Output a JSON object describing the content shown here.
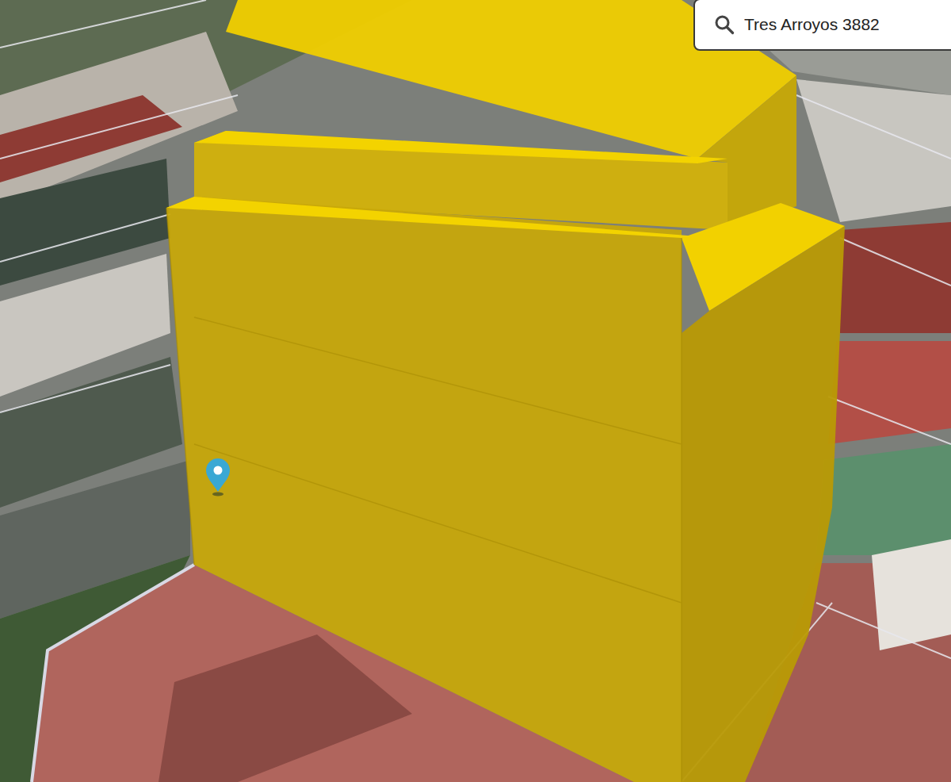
{
  "search": {
    "value": "Tres Arroyos 3882"
  }
}
